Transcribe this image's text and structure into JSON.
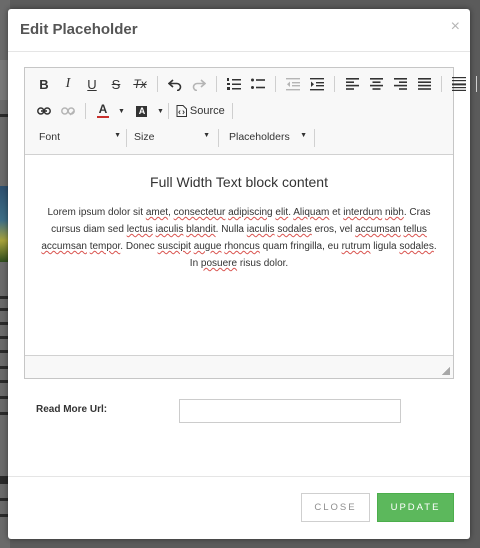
{
  "modal": {
    "title": "Edit Placeholder",
    "close_glyph": "×"
  },
  "toolbar": {
    "bold": "B",
    "italic": "I",
    "underline": "U",
    "strike": "S",
    "remove_format": "Tx",
    "source_label": "Source",
    "font_label": "Font",
    "size_label": "Size",
    "placeholders_label": "Placeholders",
    "text_color_glyph": "A",
    "bg_color_glyph": "A"
  },
  "content": {
    "heading": "Full Width Text block content",
    "paragraph": [
      {
        "t": "Lorem ipsum dolor sit ",
        "sp": false
      },
      {
        "t": "amet",
        "sp": true
      },
      {
        "t": ", ",
        "sp": false
      },
      {
        "t": "consectetur",
        "sp": true
      },
      {
        "t": " ",
        "sp": false
      },
      {
        "t": "adipiscing",
        "sp": true
      },
      {
        "t": " ",
        "sp": false
      },
      {
        "t": "elit",
        "sp": true
      },
      {
        "t": ". ",
        "sp": false
      },
      {
        "t": "Aliquam",
        "sp": true
      },
      {
        "t": " et ",
        "sp": false
      },
      {
        "t": "interdum",
        "sp": true
      },
      {
        "t": " ",
        "sp": false
      },
      {
        "t": "nibh",
        "sp": true
      },
      {
        "t": ". Cras cursus diam sed ",
        "sp": false
      },
      {
        "t": "lectus",
        "sp": true
      },
      {
        "t": " ",
        "sp": false
      },
      {
        "t": "iaculis",
        "sp": true
      },
      {
        "t": " ",
        "sp": false
      },
      {
        "t": "blandit",
        "sp": true
      },
      {
        "t": ". Nulla ",
        "sp": false
      },
      {
        "t": "iaculis",
        "sp": true
      },
      {
        "t": " ",
        "sp": false
      },
      {
        "t": "sodales",
        "sp": true
      },
      {
        "t": " eros, vel ",
        "sp": false
      },
      {
        "t": "accumsan",
        "sp": true
      },
      {
        "t": " ",
        "sp": false
      },
      {
        "t": "tellus",
        "sp": true
      },
      {
        "t": " ",
        "sp": false
      },
      {
        "t": "accumsan",
        "sp": true
      },
      {
        "t": " ",
        "sp": false
      },
      {
        "t": "tempor",
        "sp": true
      },
      {
        "t": ". Donec ",
        "sp": false
      },
      {
        "t": "suscipit",
        "sp": true
      },
      {
        "t": " ",
        "sp": false
      },
      {
        "t": "augue",
        "sp": true
      },
      {
        "t": " ",
        "sp": false
      },
      {
        "t": "rhoncus",
        "sp": true
      },
      {
        "t": " quam fringilla, eu ",
        "sp": false
      },
      {
        "t": "rutrum",
        "sp": true
      },
      {
        "t": " ligula ",
        "sp": false
      },
      {
        "t": "sodales",
        "sp": true
      },
      {
        "t": ". In ",
        "sp": false
      },
      {
        "t": "posuere",
        "sp": true
      },
      {
        "t": " risus dolor.",
        "sp": false
      }
    ]
  },
  "form": {
    "read_more_label": "Read More Url:",
    "read_more_value": ""
  },
  "footer": {
    "close_label": "CLOSE",
    "update_label": "UPDATE"
  },
  "colors": {
    "update_button": "#5cb85c",
    "spellcheck_underline": "#d9534f",
    "overlay": "#5b5b5b"
  }
}
